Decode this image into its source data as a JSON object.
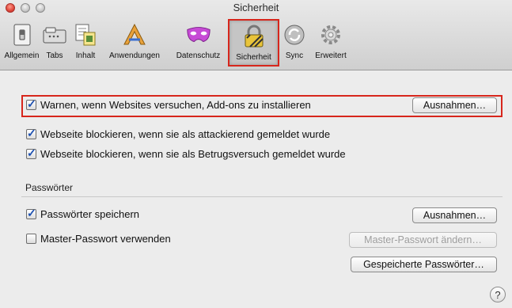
{
  "window": {
    "title": "Sicherheit"
  },
  "toolbar": {
    "items": [
      {
        "label": "Allgemein",
        "icon": "switch-icon"
      },
      {
        "label": "Tabs",
        "icon": "tabs-icon"
      },
      {
        "label": "Inhalt",
        "icon": "content-icon"
      },
      {
        "label": "Anwendungen",
        "icon": "applications-icon"
      },
      {
        "label": "Datenschutz",
        "icon": "mask-icon"
      },
      {
        "label": "Sicherheit",
        "icon": "lock-icon",
        "selected": true
      },
      {
        "label": "Sync",
        "icon": "sync-icon"
      },
      {
        "label": "Erweitert",
        "icon": "gear-icon"
      }
    ]
  },
  "security": {
    "warn_addons": {
      "label": "Warnen, wenn Websites versuchen, Add-ons zu installieren",
      "checked": true,
      "button": "Ausnahmen…"
    },
    "block_attack": {
      "label": "Webseite blockieren, wenn sie als attackierend gemeldet wurde",
      "checked": true
    },
    "block_forgery": {
      "label": "Webseite blockieren, wenn sie als Betrugsversuch gemeldet wurde",
      "checked": true
    }
  },
  "passwords": {
    "heading": "Passwörter",
    "save": {
      "label": "Passwörter speichern",
      "checked": true,
      "button": "Ausnahmen…"
    },
    "master": {
      "label": "Master-Passwort verwenden",
      "checked": false,
      "button": "Master-Passwort ändern…"
    },
    "saved_button": "Gespeicherte Passwörter…"
  },
  "help": {
    "label": "?"
  },
  "colors": {
    "highlight": "#d7261c",
    "check": "#1b4fb0"
  }
}
